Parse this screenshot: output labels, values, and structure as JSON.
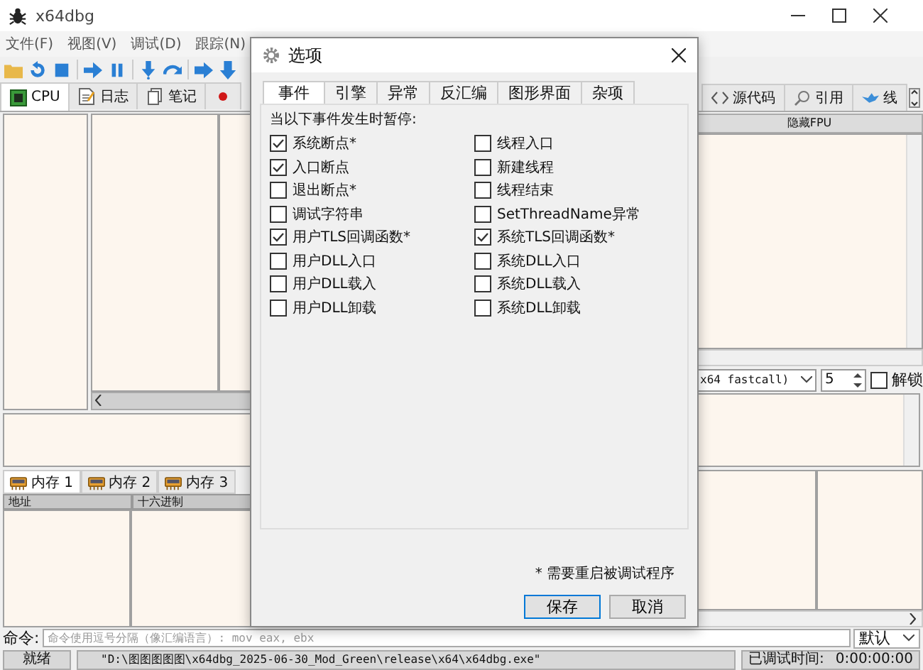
{
  "window": {
    "title": "x64dbg"
  },
  "menu": [
    {
      "label": "文件(F)"
    },
    {
      "label": "视图(V)"
    },
    {
      "label": "调试(D)"
    },
    {
      "label": "跟踪(N)"
    }
  ],
  "tabs": [
    {
      "kind": "cpu",
      "label": "CPU",
      "selected": true
    },
    {
      "kind": "log",
      "label": "日志",
      "selected": false
    },
    {
      "kind": "notes",
      "label": "笔记",
      "selected": false
    },
    {
      "kind": "breakpoints",
      "selected": false
    }
  ],
  "right_tabs": [
    {
      "kind": "source",
      "label": "源代码",
      "selected": false
    },
    {
      "kind": "references",
      "label": "引用",
      "selected": false
    },
    {
      "kind": "threads",
      "label": "线",
      "selected": false
    }
  ],
  "registers": {
    "header": "隐藏FPU"
  },
  "call_convention": {
    "value": "x64 fastcall)"
  },
  "arg_count": {
    "value": "5"
  },
  "lock": {
    "label": "解锁",
    "checked": false
  },
  "memory_tabs": [
    {
      "label": "内存 1",
      "selected": true
    },
    {
      "label": "内存 2",
      "selected": false
    },
    {
      "label": "内存 3",
      "selected": false
    }
  ],
  "dump_columns": [
    "地址",
    "十六进制"
  ],
  "command": {
    "label": "命令:",
    "placeholder": "命令使用逗号分隔（像汇编语言）: mov eax, ebx",
    "mode": "默认"
  },
  "status_bar": {
    "state": "就绪",
    "path": "\"D:\\图图图图图\\x64dbg_2025-06-30_Mod_Green\\release\\x64\\x64dbg.exe\"",
    "elapsed_label": "已调试时间:",
    "elapsed": "0:00:00:00"
  },
  "dialog": {
    "title": "选项",
    "tabs": [
      {
        "label": "事件",
        "selected": true
      },
      {
        "label": "引擎",
        "selected": false
      },
      {
        "label": "异常",
        "selected": false
      },
      {
        "label": "反汇编",
        "selected": false
      },
      {
        "label": "图形界面",
        "selected": false
      },
      {
        "label": "杂项",
        "selected": false
      }
    ],
    "group_label": "当以下事件发生时暂停:",
    "left_options": [
      {
        "label": "系统断点*",
        "checked": true
      },
      {
        "label": "入口断点",
        "checked": true
      },
      {
        "label": "退出断点*",
        "checked": false
      },
      {
        "label": "调试字符串",
        "checked": false
      },
      {
        "label": "用户TLS回调函数*",
        "checked": true
      },
      {
        "label": "用户DLL入口",
        "checked": false
      },
      {
        "label": "用户DLL载入",
        "checked": false
      },
      {
        "label": "用户DLL卸载",
        "checked": false
      }
    ],
    "right_options": [
      {
        "label": "线程入口",
        "checked": false
      },
      {
        "label": "新建线程",
        "checked": false
      },
      {
        "label": "线程结束",
        "checked": false
      },
      {
        "label": "SetThreadName异常",
        "checked": false
      },
      {
        "label": "系统TLS回调函数*",
        "checked": true
      },
      {
        "label": "系统DLL入口",
        "checked": false
      },
      {
        "label": "系统DLL载入",
        "checked": false
      },
      {
        "label": "系统DLL卸载",
        "checked": false
      }
    ],
    "note": "* 需要重启被调试程序",
    "buttons": [
      {
        "label": "保存",
        "default": true
      },
      {
        "label": "取消",
        "default": false
      }
    ]
  }
}
